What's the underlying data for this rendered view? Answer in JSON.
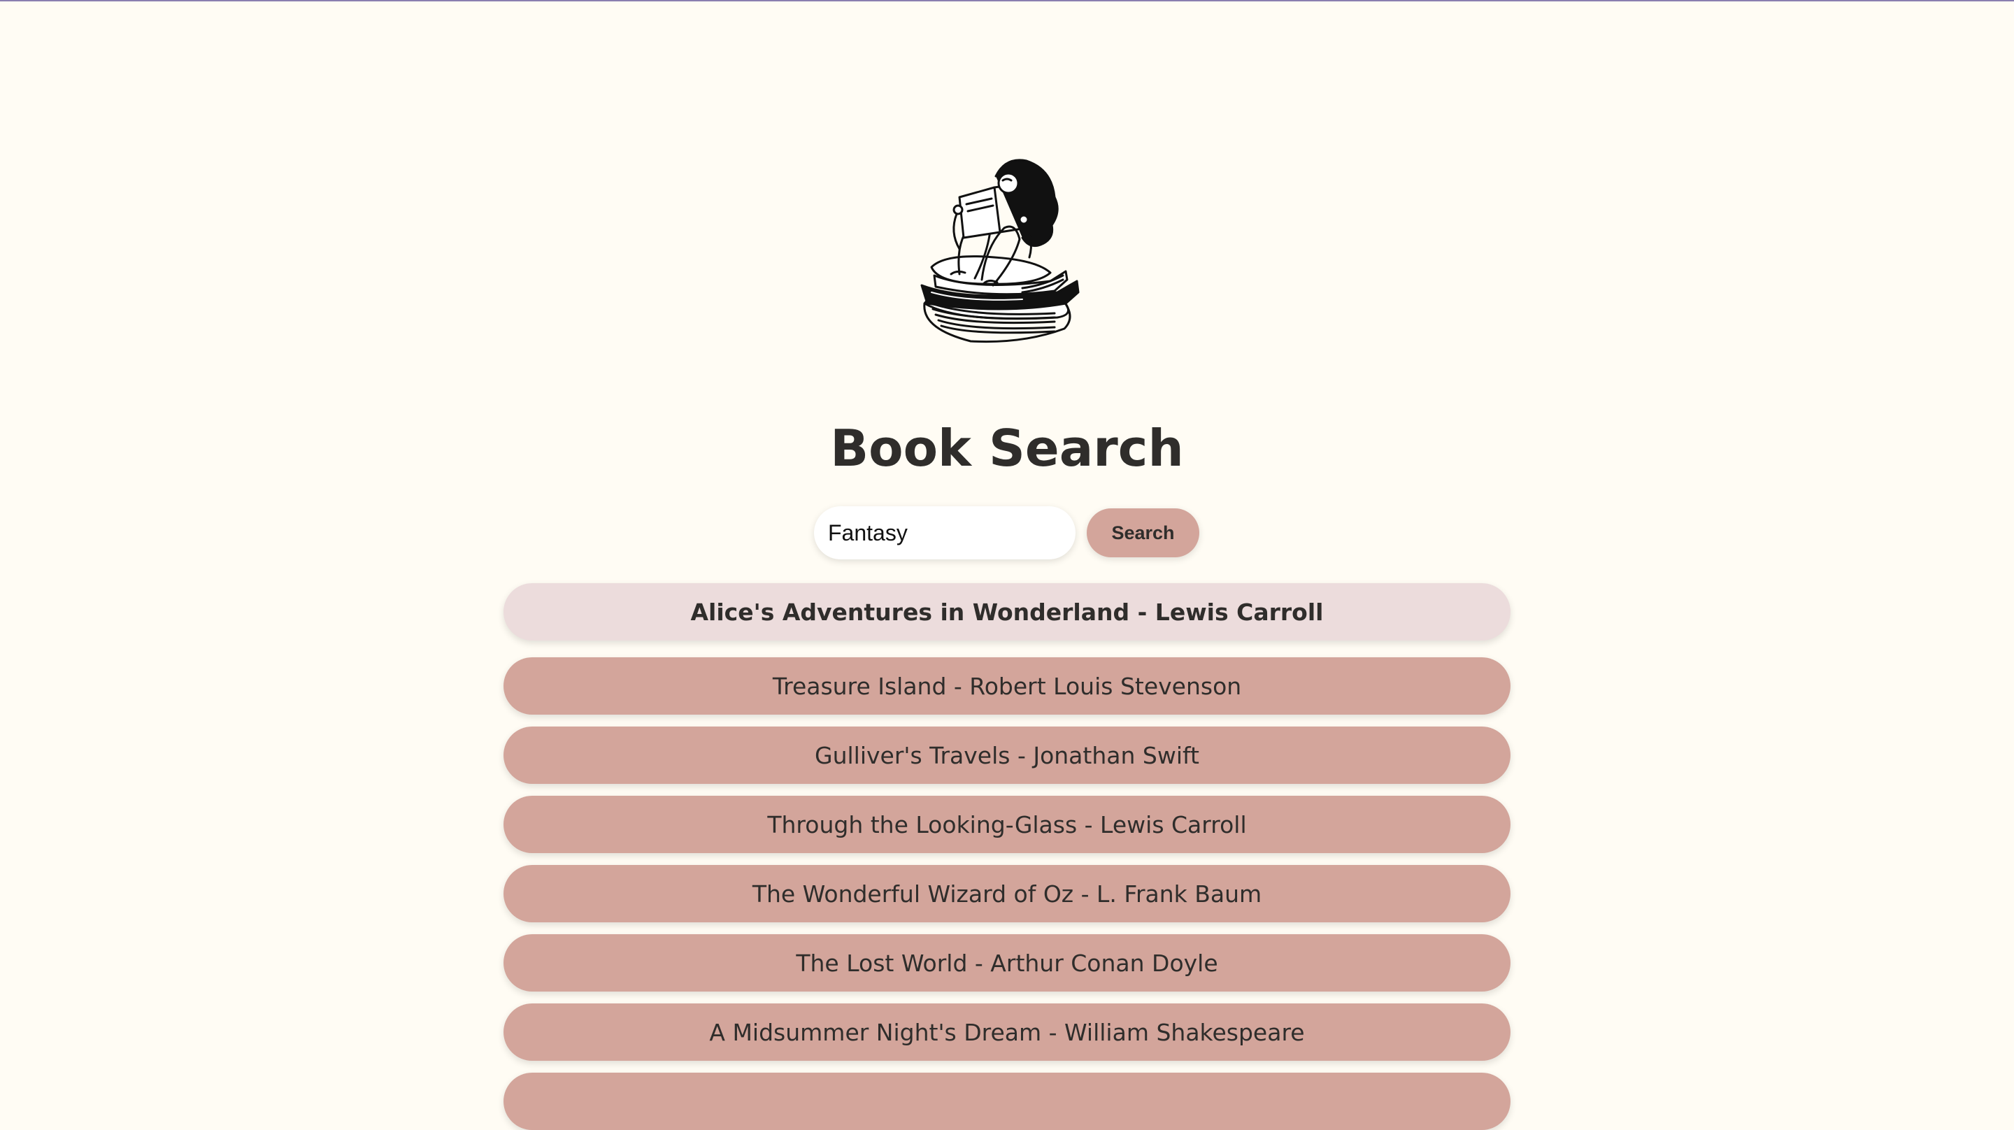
{
  "page": {
    "title": "Book Search",
    "illustration_icon": "woman-reading-on-books-illustration"
  },
  "search": {
    "value": "Fantasy",
    "button_label": "Search"
  },
  "results": [
    "Alice's Adventures in Wonderland - Lewis Carroll",
    "Treasure Island - Robert Louis Stevenson",
    "Gulliver's Travels - Jonathan Swift",
    "Through the Looking-Glass - Lewis Carroll",
    "The Wonderful Wizard of Oz - L. Frank Baum",
    "The Lost World - Arthur Conan Doyle",
    "A Midsummer Night's Dream - William Shakespeare",
    ""
  ],
  "selected_index": 0,
  "colors": {
    "background": "#fffcf4",
    "accent": "#d3a59b",
    "selected": "#ecdcdc",
    "text": "#2f2d2b"
  }
}
